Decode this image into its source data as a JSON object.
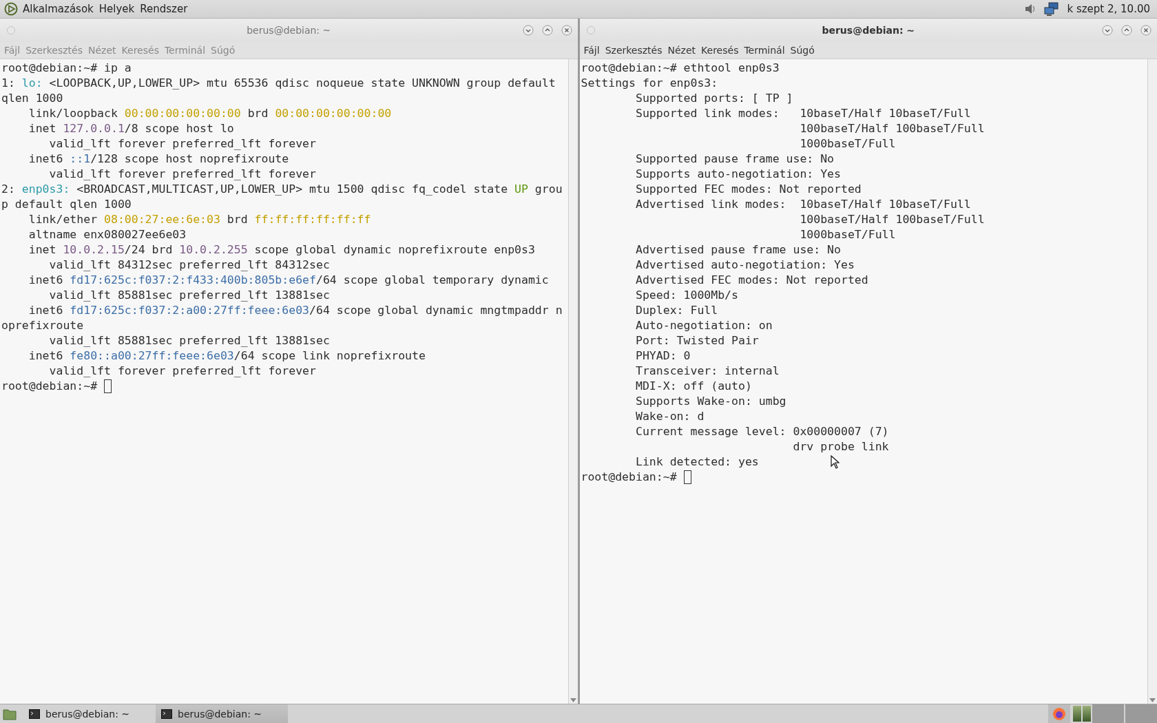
{
  "top_panel": {
    "menus": [
      "Alkalmazások",
      "Helyek",
      "Rendszer"
    ],
    "clock": "k szept 2, 10.00"
  },
  "windows": [
    {
      "title": "berus@debian: ~",
      "active": false,
      "menu": [
        "Fájl",
        "Szerkesztés",
        "Nézet",
        "Keresés",
        "Terminál",
        "Súgó"
      ],
      "cursor": true,
      "lines": [
        [
          {
            "kind": "plain",
            "text": "root@debian:~# ip a"
          }
        ],
        [
          {
            "kind": "plain",
            "text": "1: "
          },
          {
            "kind": "iface",
            "text": "lo:"
          },
          {
            "kind": "plain",
            "text": " <LOOPBACK,UP,LOWER_UP> mtu 65536 qdisc noqueue state UNKNOWN group default"
          }
        ],
        [
          {
            "kind": "plain",
            "text": "qlen 1000"
          }
        ],
        [
          {
            "kind": "plain",
            "text": "    link/loopback "
          },
          {
            "kind": "mac",
            "text": "00:00:00:00:00:00"
          },
          {
            "kind": "plain",
            "text": " brd "
          },
          {
            "kind": "mac",
            "text": "00:00:00:00:00:00"
          }
        ],
        [
          {
            "kind": "plain",
            "text": "    inet "
          },
          {
            "kind": "ipv4",
            "text": "127.0.0.1"
          },
          {
            "kind": "plain",
            "text": "/8 scope host lo"
          }
        ],
        [
          {
            "kind": "plain",
            "text": "       valid_lft forever preferred_lft forever"
          }
        ],
        [
          {
            "kind": "plain",
            "text": "    inet6 "
          },
          {
            "kind": "ipv6",
            "text": "::1"
          },
          {
            "kind": "plain",
            "text": "/128 scope host noprefixroute"
          }
        ],
        [
          {
            "kind": "plain",
            "text": "       valid_lft forever preferred_lft forever"
          }
        ],
        [
          {
            "kind": "plain",
            "text": "2: "
          },
          {
            "kind": "iface",
            "text": "enp0s3:"
          },
          {
            "kind": "plain",
            "text": " <BROADCAST,MULTICAST,UP,LOWER_UP> mtu 1500 qdisc fq_codel state "
          },
          {
            "kind": "up",
            "text": "UP"
          },
          {
            "kind": "plain",
            "text": " grou"
          }
        ],
        [
          {
            "kind": "plain",
            "text": "p default qlen 1000"
          }
        ],
        [
          {
            "kind": "plain",
            "text": "    link/ether "
          },
          {
            "kind": "mac",
            "text": "08:00:27:ee:6e:03"
          },
          {
            "kind": "plain",
            "text": " brd "
          },
          {
            "kind": "mac",
            "text": "ff:ff:ff:ff:ff:ff"
          }
        ],
        [
          {
            "kind": "plain",
            "text": "    altname enx080027ee6e03"
          }
        ],
        [
          {
            "kind": "plain",
            "text": "    inet "
          },
          {
            "kind": "ipv4",
            "text": "10.0.2.15"
          },
          {
            "kind": "plain",
            "text": "/24 brd "
          },
          {
            "kind": "ipv4",
            "text": "10.0.2.255"
          },
          {
            "kind": "plain",
            "text": " scope global dynamic noprefixroute enp0s3"
          }
        ],
        [
          {
            "kind": "plain",
            "text": "       valid_lft 84312sec preferred_lft 84312sec"
          }
        ],
        [
          {
            "kind": "plain",
            "text": "    inet6 "
          },
          {
            "kind": "ipv6",
            "text": "fd17:625c:f037:2:f433:400b:805b:e6ef"
          },
          {
            "kind": "plain",
            "text": "/64 scope global temporary dynamic"
          }
        ],
        [
          {
            "kind": "plain",
            "text": "       valid_lft 85881sec preferred_lft 13881sec"
          }
        ],
        [
          {
            "kind": "plain",
            "text": "    inet6 "
          },
          {
            "kind": "ipv6",
            "text": "fd17:625c:f037:2:a00:27ff:feee:6e03"
          },
          {
            "kind": "plain",
            "text": "/64 scope global dynamic mngtmpaddr n"
          }
        ],
        [
          {
            "kind": "plain",
            "text": "oprefixroute"
          }
        ],
        [
          {
            "kind": "plain",
            "text": "       valid_lft 85881sec preferred_lft 13881sec"
          }
        ],
        [
          {
            "kind": "plain",
            "text": "    inet6 "
          },
          {
            "kind": "ipv6",
            "text": "fe80::a00:27ff:feee:6e03"
          },
          {
            "kind": "plain",
            "text": "/64 scope link noprefixroute"
          }
        ],
        [
          {
            "kind": "plain",
            "text": "       valid_lft forever preferred_lft forever"
          }
        ],
        [
          {
            "kind": "plain",
            "text": "root@debian:~# "
          }
        ]
      ]
    },
    {
      "title": "berus@debian: ~",
      "active": true,
      "menu": [
        "Fájl",
        "Szerkesztés",
        "Nézet",
        "Keresés",
        "Terminál",
        "Súgó"
      ],
      "cursor": true,
      "lines": [
        [
          {
            "kind": "plain",
            "text": "root@debian:~# ethtool enp0s3"
          }
        ],
        [
          {
            "kind": "plain",
            "text": "Settings for enp0s3:"
          }
        ],
        [
          {
            "kind": "plain",
            "text": "        Supported ports: [ TP ]"
          }
        ],
        [
          {
            "kind": "plain",
            "text": "        Supported link modes:   10baseT/Half 10baseT/Full"
          }
        ],
        [
          {
            "kind": "plain",
            "text": "                                100baseT/Half 100baseT/Full"
          }
        ],
        [
          {
            "kind": "plain",
            "text": "                                1000baseT/Full"
          }
        ],
        [
          {
            "kind": "plain",
            "text": "        Supported pause frame use: No"
          }
        ],
        [
          {
            "kind": "plain",
            "text": "        Supports auto-negotiation: Yes"
          }
        ],
        [
          {
            "kind": "plain",
            "text": "        Supported FEC modes: Not reported"
          }
        ],
        [
          {
            "kind": "plain",
            "text": "        Advertised link modes:  10baseT/Half 10baseT/Full"
          }
        ],
        [
          {
            "kind": "plain",
            "text": "                                100baseT/Half 100baseT/Full"
          }
        ],
        [
          {
            "kind": "plain",
            "text": "                                1000baseT/Full"
          }
        ],
        [
          {
            "kind": "plain",
            "text": "        Advertised pause frame use: No"
          }
        ],
        [
          {
            "kind": "plain",
            "text": "        Advertised auto-negotiation: Yes"
          }
        ],
        [
          {
            "kind": "plain",
            "text": "        Advertised FEC modes: Not reported"
          }
        ],
        [
          {
            "kind": "plain",
            "text": "        Speed: 1000Mb/s"
          }
        ],
        [
          {
            "kind": "plain",
            "text": "        Duplex: Full"
          }
        ],
        [
          {
            "kind": "plain",
            "text": "        Auto-negotiation: on"
          }
        ],
        [
          {
            "kind": "plain",
            "text": "        Port: Twisted Pair"
          }
        ],
        [
          {
            "kind": "plain",
            "text": "        PHYAD: 0"
          }
        ],
        [
          {
            "kind": "plain",
            "text": "        Transceiver: internal"
          }
        ],
        [
          {
            "kind": "plain",
            "text": "        MDI-X: off (auto)"
          }
        ],
        [
          {
            "kind": "plain",
            "text": "        Supports Wake-on: umbg"
          }
        ],
        [
          {
            "kind": "plain",
            "text": "        Wake-on: d"
          }
        ],
        [
          {
            "kind": "plain",
            "text": "        Current message level: 0x00000007 (7)"
          }
        ],
        [
          {
            "kind": "plain",
            "text": "                               drv probe link"
          }
        ],
        [
          {
            "kind": "plain",
            "text": "        Link detected: yes"
          }
        ],
        [
          {
            "kind": "plain",
            "text": "root@debian:~# "
          }
        ]
      ]
    }
  ],
  "taskbar": {
    "tasks": [
      {
        "label": "berus@debian: ~",
        "selected": false
      },
      {
        "label": "berus@debian: ~",
        "selected": true
      }
    ]
  }
}
